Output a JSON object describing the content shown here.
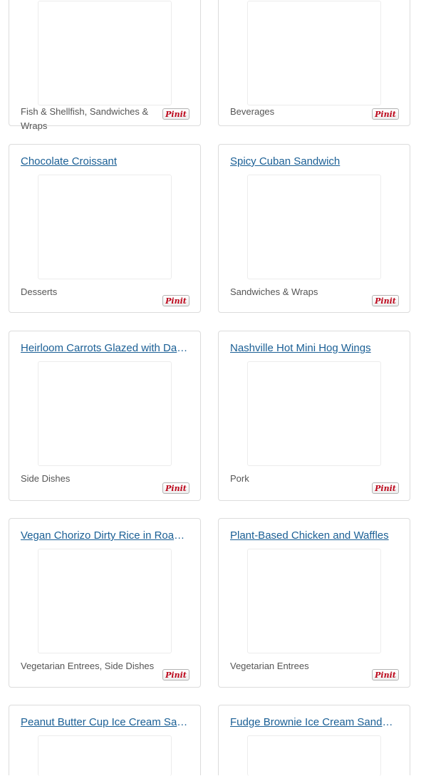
{
  "pin_button_label": "Pinit",
  "cards": [
    {
      "title": "",
      "category": "Fish & Shellfish, Sandwiches & Wraps"
    },
    {
      "title": "",
      "category": "Beverages"
    },
    {
      "title": "Chocolate Croissant",
      "category": "Desserts"
    },
    {
      "title": "Spicy Cuban Sandwich",
      "category": "Sandwiches & Wraps"
    },
    {
      "title": "Heirloom Carrots Glazed with Dates",
      "category": "Side Dishes"
    },
    {
      "title": "Nashville Hot Mini Hog Wings",
      "category": "Pork"
    },
    {
      "title": "Vegan Chorizo Dirty Rice in Roasted Peppers",
      "category": "Vegetarian Entrees, Side Dishes"
    },
    {
      "title": "Plant-Based Chicken and Waffles",
      "category": "Vegetarian Entrees"
    },
    {
      "title": "Peanut Butter Cup Ice Cream Sandwich",
      "category": ""
    },
    {
      "title": "Fudge Brownie Ice Cream Sandwich",
      "category": ""
    }
  ]
}
